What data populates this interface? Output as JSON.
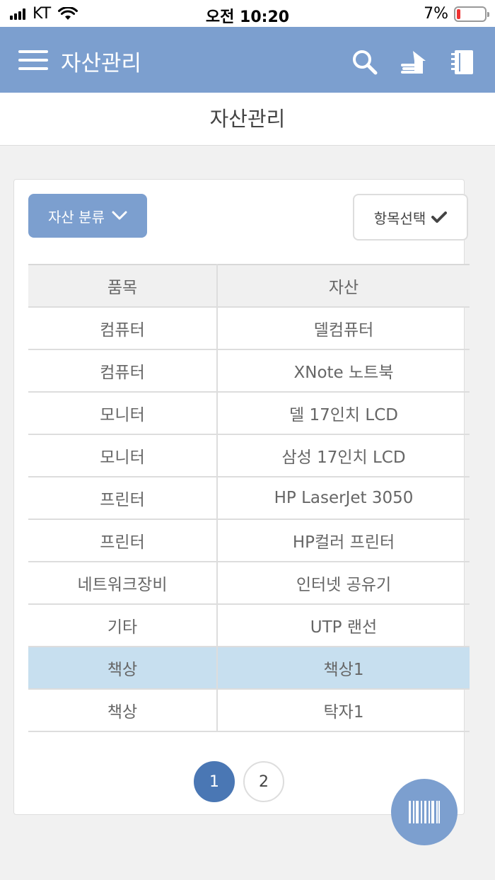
{
  "status_bar": {
    "carrier": "KT",
    "time": "오전 10:20",
    "battery": "7%"
  },
  "app_bar": {
    "title": "자산관리",
    "icons": [
      "menu-icon",
      "search-icon",
      "home-stack-icon",
      "notebook-icon"
    ]
  },
  "page_title": "자산관리",
  "controls": {
    "category_button": "자산 분류",
    "select_button": "항목선택"
  },
  "table": {
    "headers": [
      "품목",
      "자산"
    ],
    "rows": [
      [
        "컴퓨터",
        "델컴퓨터"
      ],
      [
        "컴퓨터",
        "XNote 노트북"
      ],
      [
        "모니터",
        "델 17인치 LCD"
      ],
      [
        "모니터",
        "삼성 17인치 LCD"
      ],
      [
        "프린터",
        "HP LaserJet 3050"
      ],
      [
        "프린터",
        "HP컬러 프린터"
      ],
      [
        "네트워크장비",
        "인터넷 공유기"
      ],
      [
        "기타",
        "UTP 랜선"
      ],
      [
        "책상",
        "책상1"
      ],
      [
        "책상",
        "탁자1"
      ]
    ],
    "selected_row": 8
  },
  "pagination": {
    "pages": [
      "1",
      "2"
    ],
    "current": "1"
  },
  "colors": {
    "primary": "#7c9fcf",
    "active_page": "#4a77b4",
    "selected_row": "#c7dfef"
  }
}
